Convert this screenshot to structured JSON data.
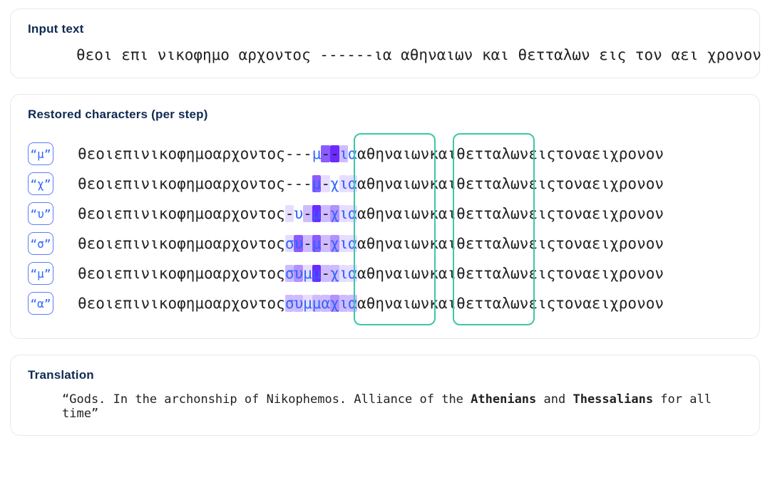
{
  "section_input": {
    "title": "Input text"
  },
  "section_restored": {
    "title": "Restored characters (per step)"
  },
  "section_translation": {
    "title": "Translation"
  },
  "tokens": [
    {
      "t": "θεοι"
    },
    {
      "t": " "
    },
    {
      "t": "επι"
    },
    {
      "t": " "
    },
    {
      "t": "νικοφημο"
    },
    {
      "t": " "
    },
    {
      "t": "αρχοντος"
    },
    {
      "t": " "
    },
    {
      "t": "?",
      "slot": 0
    },
    {
      "t": "?",
      "slot": 1
    },
    {
      "t": "?",
      "slot": 2
    },
    {
      "t": "?",
      "slot": 3
    },
    {
      "t": "?",
      "slot": 4
    },
    {
      "t": "?",
      "slot": 5
    },
    {
      "t": "ι",
      "tail": true
    },
    {
      "t": "α",
      "tail": true
    },
    {
      "t": " "
    },
    {
      "t": "αθηναιων",
      "box": "a"
    },
    {
      "t": " "
    },
    {
      "t": "και"
    },
    {
      "t": " "
    },
    {
      "t": "θετταλων",
      "box": "b"
    },
    {
      "t": " "
    },
    {
      "t": "εις"
    },
    {
      "t": " "
    },
    {
      "t": "τον"
    },
    {
      "t": " "
    },
    {
      "t": "αει"
    },
    {
      "t": " "
    },
    {
      "t": "χρονον"
    }
  ],
  "steps": [
    {
      "tag": "“μ”",
      "fill": {
        "3": "μ"
      },
      "shade": {
        "0": 0,
        "1": 0,
        "2": 0,
        "3": 0,
        "4": 4,
        "5": 5,
        "ι": 2,
        "α": 0
      }
    },
    {
      "tag": "“χ”",
      "fill": {
        "3": "μ",
        "5": "χ"
      },
      "shade": {
        "0": 0,
        "1": 0,
        "2": 0,
        "3": 4,
        "4": 1,
        "5": 0,
        "ι": 1,
        "α": 1
      }
    },
    {
      "tag": "“υ”",
      "fill": {
        "1": "υ",
        "3": "μ",
        "5": "χ"
      },
      "shade": {
        "0": 1,
        "1": 0,
        "2": 2,
        "3": 5,
        "4": 2,
        "5": 3,
        "ι": 1,
        "α": 1
      }
    },
    {
      "tag": "“σ”",
      "fill": {
        "0": "σ",
        "1": "υ",
        "3": "μ",
        "5": "χ"
      },
      "shade": {
        "0": 1,
        "1": 4,
        "2": 2,
        "3": 4,
        "4": 2,
        "5": 3,
        "ι": 1,
        "α": 1
      }
    },
    {
      "tag": "“μ”",
      "fill": {
        "0": "σ",
        "1": "υ",
        "2": "μ",
        "3": "μ",
        "5": "χ"
      },
      "shade": {
        "0": 2,
        "1": 3,
        "2": 1,
        "3": 5,
        "4": 2,
        "5": 2,
        "ι": 1,
        "α": 1
      }
    },
    {
      "tag": "“α”",
      "fill": {
        "0": "σ",
        "1": "υ",
        "2": "μ",
        "3": "μ",
        "4": "α",
        "5": "χ"
      },
      "shade": {
        "0": 2,
        "1": 2,
        "2": 1,
        "3": 2,
        "4": 2,
        "5": 3,
        "ι": 2,
        "α": 2
      }
    }
  ],
  "input_slot_char": "-",
  "translation": {
    "pre": "“Gods. In the archonship of Nikophemos. Alliance of the ",
    "b1": "Athenians",
    "mid": " and ",
    "b2": "Thessalians",
    "post": " for all time”"
  }
}
